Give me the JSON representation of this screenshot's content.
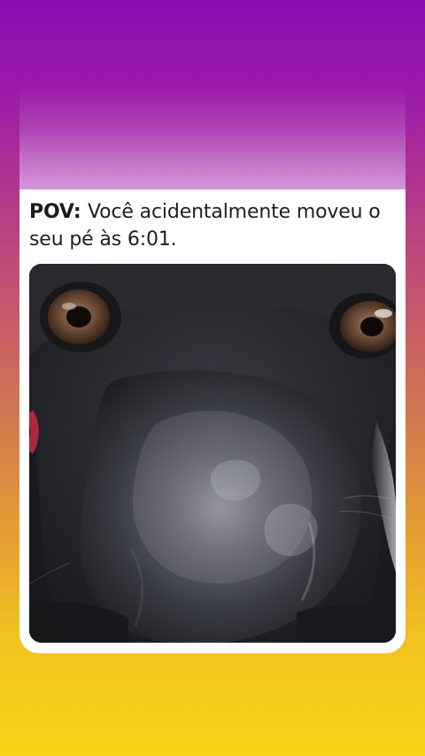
{
  "post": {
    "caption_lead": "POV:",
    "caption_text": "Você acidentalmente moveu o seu pé às 6:01."
  },
  "colors": {
    "background_top": "#8a0cb1",
    "background_bottom": "#f8d515",
    "card": "#ffffff",
    "text": "#1f1f1f"
  },
  "image": {
    "subject": "close-up dog face"
  }
}
